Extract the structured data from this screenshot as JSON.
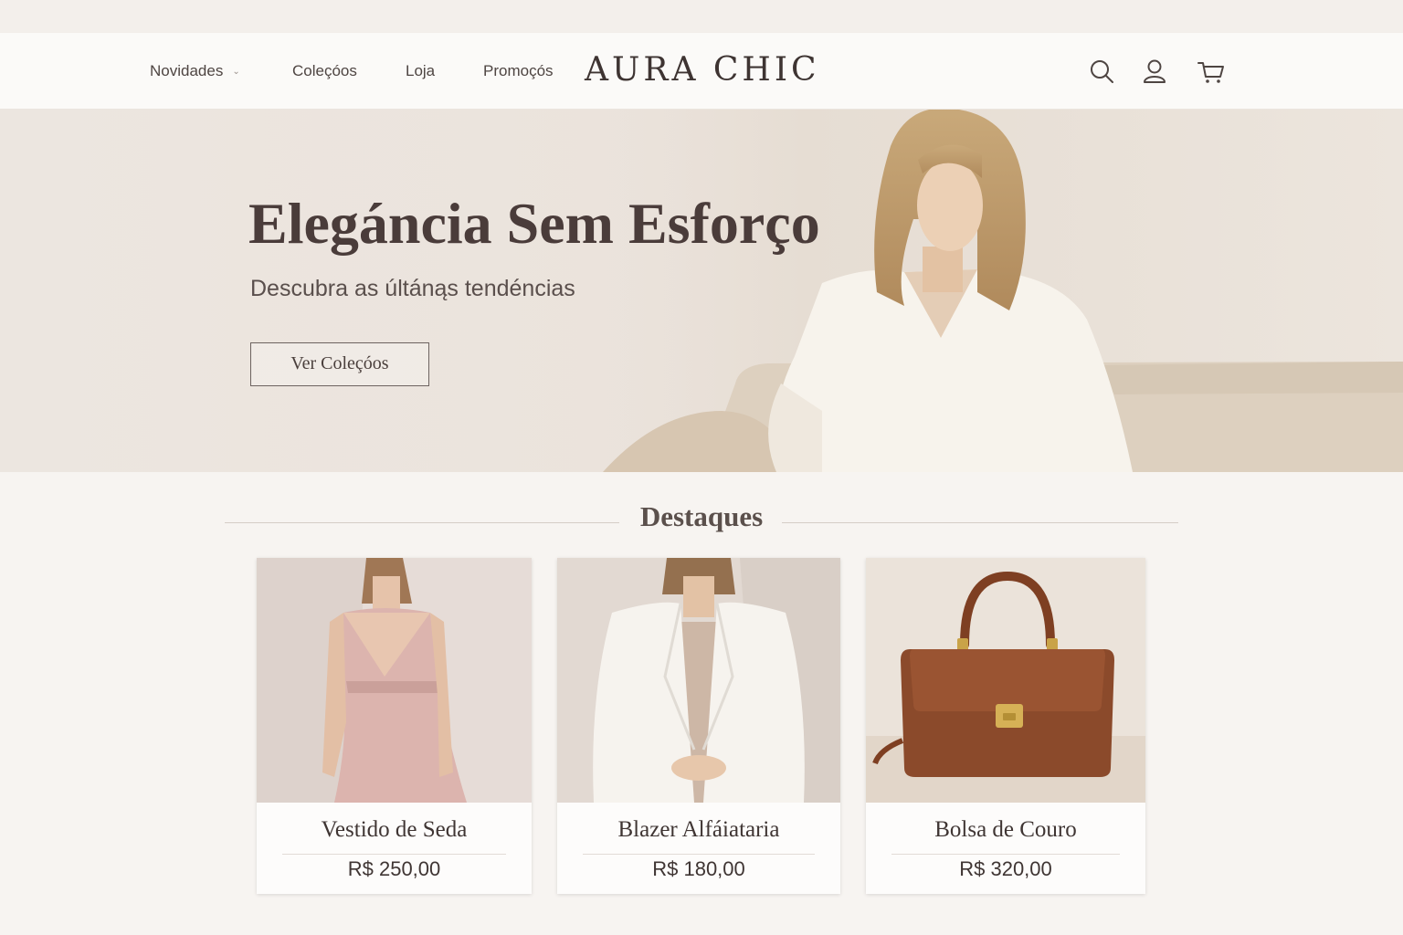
{
  "header": {
    "nav": [
      {
        "label": "Novidades",
        "has_dropdown": true
      },
      {
        "label": "Coleçóos"
      },
      {
        "label": "Loja"
      },
      {
        "label": "Promoçós"
      }
    ],
    "brand": "AURA CHIC",
    "icons": [
      "search-icon",
      "user-icon",
      "cart-icon"
    ]
  },
  "hero": {
    "title": "Elegáncia Sem Esforço",
    "subtitle": "Descubra as últánąs tendéncias",
    "cta_label": "Ver Coleçóos"
  },
  "featured": {
    "title": "Destaques",
    "products": [
      {
        "name": "Vestido de Seda",
        "price": "R$ 250,00"
      },
      {
        "name": "Blazer Alfáiataria",
        "price": "R$ 180,00"
      },
      {
        "name": "Bolsa de Couro",
        "price": "R$ 320,00"
      }
    ]
  },
  "colors": {
    "background": "#f7f4f1",
    "text": "#4a3f3c",
    "accent": "#8b4a2b"
  }
}
